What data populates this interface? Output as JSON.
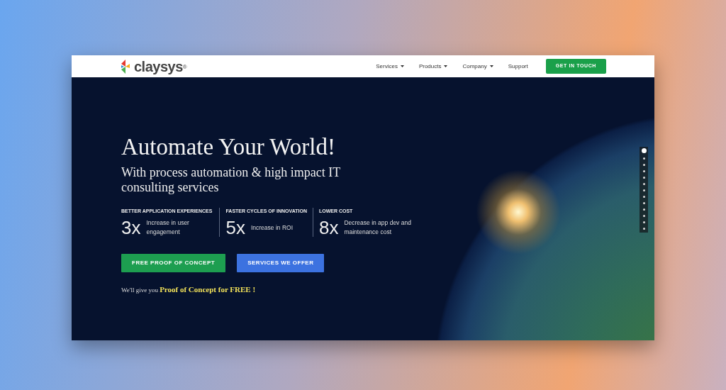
{
  "logo": {
    "text": "claysys$^{®}$"
  },
  "nav": [
    {
      "label": "Services",
      "dropdown": true
    },
    {
      "label": "Products",
      "dropdown": true
    },
    {
      "label": "Company",
      "dropdown": true
    },
    {
      "label": "Support",
      "dropdown": false
    }
  ],
  "cta": "GET IN TOUCH",
  "hero": {
    "title": "Automate Your World!",
    "subtitle": "With process automation & high impact IT consulting services",
    "stats": [
      {
        "heading": "BETTER APPLICATION EXPERIENCES",
        "value": "3x",
        "caption": "Increase in user engagement"
      },
      {
        "heading": "FASTER CYCLES OF INNOVATION",
        "value": "5x",
        "caption": "Increase in ROI"
      },
      {
        "heading": "LOWER COST",
        "value": "8x",
        "caption": "Decrease in app dev and maintenance cost"
      }
    ],
    "buttons": [
      {
        "label": "FREE PROOF OF CONCEPT",
        "kind": "primary"
      },
      {
        "label": "SERVICES WE OFFER",
        "kind": "secondary"
      }
    ],
    "note": "We'll give you **Proof of Concept for FREE !**"
  },
  "pager": [
    {
      "selected": true
    },
    {
      "selected": false
    },
    {
      "selected": false
    },
    {
      "selected": false
    },
    {
      "selected": false
    },
    {
      "selected": false
    },
    {
      "selected": false
    },
    {
      "selected": false
    },
    {
      "selected": false
    },
    {
      "selected": false
    },
    {
      "selected": false
    },
    {
      "selected": false
    },
    {
      "selected": false
    }
  ]
}
